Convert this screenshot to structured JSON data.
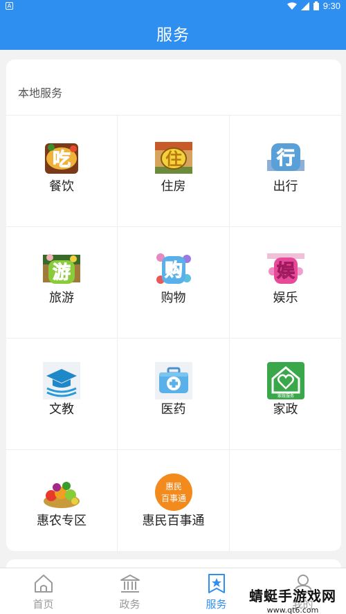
{
  "status_bar": {
    "left_badge": "A",
    "time": "9:30"
  },
  "header": {
    "title": "服务"
  },
  "section": {
    "title": "本地服务",
    "items": [
      {
        "label": "餐饮",
        "icon": "eat-icon",
        "glyph": "吃"
      },
      {
        "label": "住房",
        "icon": "housing-icon",
        "glyph": "住"
      },
      {
        "label": "出行",
        "icon": "travel-icon",
        "glyph": "行"
      },
      {
        "label": "旅游",
        "icon": "tourism-icon",
        "glyph": "游"
      },
      {
        "label": "购物",
        "icon": "shopping-icon",
        "glyph": "购"
      },
      {
        "label": "娱乐",
        "icon": "entertainment-icon",
        "glyph": "娱"
      },
      {
        "label": "文教",
        "icon": "graduation-cap-icon"
      },
      {
        "label": "医药",
        "icon": "medical-kit-icon"
      },
      {
        "label": "家政",
        "icon": "home-heart-icon",
        "glyph": "家政服务"
      },
      {
        "label": "惠农专区",
        "icon": "fruits-vegetables-icon"
      },
      {
        "label": "惠民百事通",
        "icon": "huimin-badge-icon",
        "glyph_line1": "惠民",
        "glyph_line2": "百事通"
      }
    ]
  },
  "tabbar": {
    "tabs": [
      {
        "label": "首页",
        "icon": "home-icon"
      },
      {
        "label": "政务",
        "icon": "government-building-icon"
      },
      {
        "label": "服务",
        "icon": "service-star-icon",
        "active": true
      },
      {
        "label": "我的",
        "icon": "user-icon"
      }
    ]
  },
  "watermark": {
    "main": "蜻蜓手游戏网",
    "sub": "www.qt6.com"
  },
  "colors": {
    "primary": "#2f8ff0",
    "background": "#f2f2f2"
  }
}
